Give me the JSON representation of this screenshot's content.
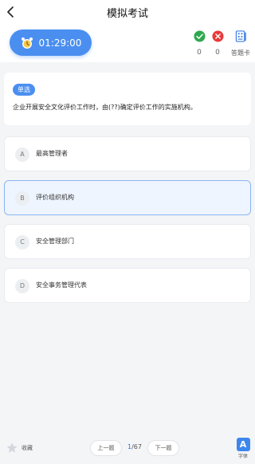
{
  "nav": {
    "title": "模拟考试"
  },
  "timer": {
    "value": "01:29:00"
  },
  "stats": {
    "correct": "0",
    "wrong": "0",
    "answer_card_label": "答题卡"
  },
  "question": {
    "type_badge": "单选",
    "text": "企业开展安全文化评价工作时，由(??)确定评价工作的实施机构。"
  },
  "options": [
    {
      "letter": "A",
      "text": "最高管理者"
    },
    {
      "letter": "B",
      "text": "评价组织机构"
    },
    {
      "letter": "C",
      "text": "安全管理部门"
    },
    {
      "letter": "D",
      "text": "安全事务管理代表"
    }
  ],
  "selected_option": "B",
  "bottom": {
    "favorite_label": "收藏",
    "prev_label": "上一题",
    "next_label": "下一题",
    "current_page": "1",
    "total_pages": "/67",
    "font_label": "字体",
    "font_icon_text": "A"
  },
  "colors": {
    "accent": "#4a8ff0",
    "correct": "#2fa84f",
    "wrong": "#e83a3a",
    "selected_bg": "#eef5ff"
  }
}
